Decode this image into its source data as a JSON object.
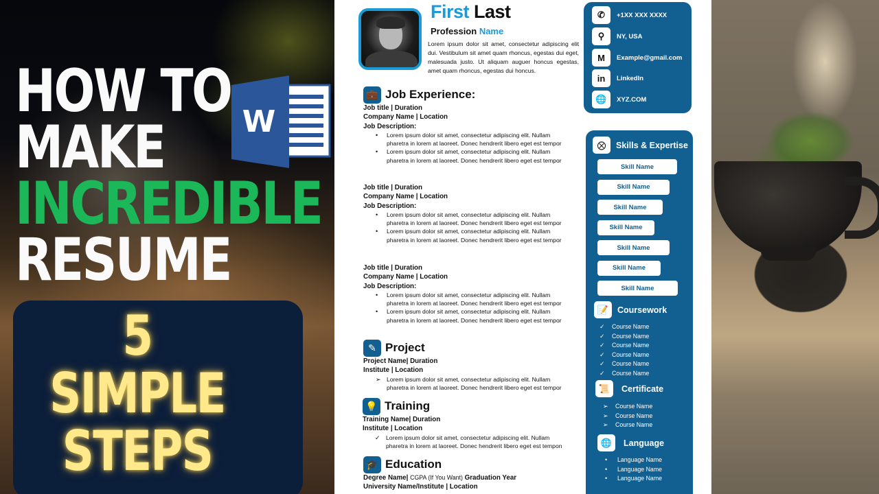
{
  "thumbnail": {
    "headline_lines": [
      "HOW TO",
      "MAKE",
      "INCREDIBLE",
      "RESUME"
    ],
    "headline_highlight_color": "#1bb759",
    "app_logo": {
      "icon": "microsoft-word-icon",
      "letter": "W",
      "color": "#2b579a"
    },
    "steps_lines": [
      "5",
      "SIMPLE",
      "STEPS"
    ],
    "steps_color": "#ffe98a"
  },
  "resume": {
    "accent_color": "#1a9ad6",
    "panel_color": "#125f91",
    "header": {
      "first_name": "First",
      "last_name": "Last",
      "profession_label": "Profession",
      "profession_accent": "Name",
      "summary": "Lorem ipsum dolor sit amet, consectetur adipiscing elit dui. Vestibulum sit amet quam rhoncus, egestas dui eget, malesuada justo. Ut aliquam auguer honcus egestas, amet quam rhoncus, egestas dui honcus."
    },
    "contact": [
      {
        "icon": "phone-icon",
        "glyph": "✆",
        "text": "+1XX XXX XXXX"
      },
      {
        "icon": "location-pin-icon",
        "glyph": "⚲",
        "text": "NY, USA"
      },
      {
        "icon": "gmail-icon",
        "glyph": "M",
        "text": "Example@gmail.com"
      },
      {
        "icon": "linkedin-icon",
        "glyph": "in",
        "text": "LinkedIn"
      },
      {
        "icon": "globe-icon",
        "glyph": "🌐",
        "text": "XYZ.COM"
      }
    ],
    "job_experience": {
      "title": "Job Experience:",
      "icon": "briefcase-icon",
      "jobs": [
        {
          "title_line": "Job title | Duration",
          "company_line": "Company Name | Location",
          "desc_label": "Job Description:",
          "bullets": [
            "Lorem ipsum dolor sit amet, consectetur adipiscing elit. Nullam pharetra in lorem at laoreet. Donec hendrerit libero eget est tempor",
            "Lorem ipsum dolor sit amet, consectetur adipiscing elit. Nullam pharetra in lorem at laoreet. Donec hendrerit libero eget est tempor"
          ]
        },
        {
          "title_line": "Job title | Duration",
          "company_line": "Company Name | Location",
          "desc_label": "Job Description:",
          "bullets": [
            "Lorem ipsum dolor sit amet, consectetur adipiscing elit. Nullam pharetra in lorem at laoreet. Donec hendrerit libero eget est tempor",
            "Lorem ipsum dolor sit amet, consectetur adipiscing elit. Nullam pharetra in lorem at laoreet. Donec hendrerit libero eget est tempor"
          ]
        },
        {
          "title_line": "Job title | Duration",
          "company_line": "Company Name | Location",
          "desc_label": "Job Description:",
          "bullets": [
            "Lorem ipsum dolor sit amet, consectetur adipiscing elit. Nullam pharetra in lorem at laoreet. Donec hendrerit libero eget est tempor",
            "Lorem ipsum dolor sit amet, consectetur adipiscing elit. Nullam pharetra in lorem at laoreet. Donec hendrerit libero eget est tempor"
          ]
        }
      ]
    },
    "project": {
      "title": "Project",
      "icon": "document-edit-icon",
      "line1": "Project Name| Duration",
      "line2": "Institute | Location",
      "bullet": "Lorem ipsum dolor sit amet, consectetur adipiscing elit. Nullam pharetra in lorem at laoreet. Donec hendrerit libero eget est tempor"
    },
    "training": {
      "title": "Training",
      "icon": "lightbulb-icon",
      "line1": "Training Name| Duration",
      "line2": "Institute | Location",
      "bullet": "Lorem ipsum dolor sit amet, consectetur adipiscing elit. Nullam pharetra in lorem at laoreet. Donec hendrerit libero eget est tempon"
    },
    "education": {
      "title": "Education",
      "icon": "graduation-cap-icon",
      "degree": "Degree Name|",
      "cgpa": "CGPA (If You Want)",
      "year": "Graduation Year",
      "line2": "University Name/Institute | Location"
    },
    "skills": {
      "title": "Skills & Expertise",
      "icon": "tools-icon",
      "items": [
        {
          "name": "Skill Name",
          "level": 0.99
        },
        {
          "name": "Skill Name",
          "level": 0.9
        },
        {
          "name": "Skill Name",
          "level": 0.81
        },
        {
          "name": "Skill Name",
          "level": 0.71
        },
        {
          "name": "Skill Name",
          "level": 0.9
        },
        {
          "name": "Skill Name",
          "level": 0.79
        },
        {
          "name": "Skill Name",
          "level": 1.0
        }
      ]
    },
    "coursework": {
      "title": "Coursework",
      "icon": "notepad-icon",
      "items": [
        "Course Name",
        "Course Name",
        "Course Name",
        "Course Name",
        "Course Name",
        "Course Name"
      ]
    },
    "certificate": {
      "title": "Certificate",
      "icon": "certificate-icon",
      "items": [
        "Course Name",
        "Course Name",
        "Course Name"
      ]
    },
    "language": {
      "title": "Language",
      "icon": "globe-language-icon",
      "items": [
        "Language Name",
        "Language Name",
        "Language Name"
      ]
    }
  }
}
